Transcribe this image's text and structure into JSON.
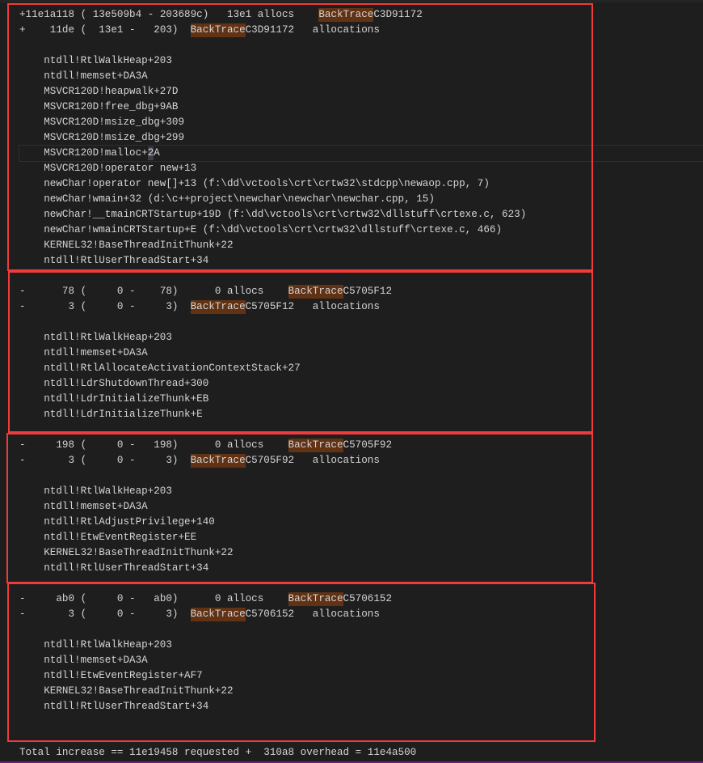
{
  "highlight_term": "BackTrace",
  "colors": {
    "highlight": "#613214",
    "box": "#ef3b3b",
    "background": "#1e1e1e",
    "text": "#d4d4d4"
  },
  "blocks": [
    {
      "header": [
        "+11e1a118 ( 13e509b4 - 203689c)   13e1 allocs    BackTraceC3D91172",
        "+    11de (  13e1 -   203)  BackTraceC3D91172   allocations"
      ],
      "frames": [
        "ntdll!RtlWalkHeap+203",
        "ntdll!memset+DA3A",
        "MSVCR120D!heapwalk+27D",
        "MSVCR120D!free_dbg+9AB",
        "MSVCR120D!msize_dbg+309",
        "MSVCR120D!msize_dbg+299",
        "MSVCR120D!malloc+2A",
        "MSVCR120D!operator new+13",
        "newChar!operator new[]+13 (f:\\dd\\vctools\\crt\\crtw32\\stdcpp\\newaop.cpp, 7)",
        "newChar!wmain+32 (d:\\c++project\\newchar\\newchar\\newchar.cpp, 15)",
        "newChar!__tmainCRTStartup+19D (f:\\dd\\vctools\\crt\\crtw32\\dllstuff\\crtexe.c, 623)",
        "newChar!wmainCRTStartup+E (f:\\dd\\vctools\\crt\\crtw32\\dllstuff\\crtexe.c, 466)",
        "KERNEL32!BaseThreadInitThunk+22",
        "ntdll!RtlUserThreadStart+34"
      ],
      "trailing_blank": 1
    },
    {
      "header": [
        "-      78 (     0 -    78)      0 allocs    BackTraceC5705F12",
        "-       3 (     0 -     3)  BackTraceC5705F12   allocations"
      ],
      "frames": [
        "ntdll!RtlWalkHeap+203",
        "ntdll!memset+DA3A",
        "ntdll!RtlAllocateActivationContextStack+27",
        "ntdll!LdrShutdownThread+300",
        "ntdll!LdrInitializeThunk+EB",
        "ntdll!LdrInitializeThunk+E"
      ],
      "trailing_blank": 1
    },
    {
      "header": [
        "-     198 (     0 -   198)      0 allocs    BackTraceC5705F92",
        "-       3 (     0 -     3)  BackTraceC5705F92   allocations"
      ],
      "frames": [
        "ntdll!RtlWalkHeap+203",
        "ntdll!memset+DA3A",
        "ntdll!RtlAdjustPrivilege+140",
        "ntdll!EtwEventRegister+EE",
        "KERNEL32!BaseThreadInitThunk+22",
        "ntdll!RtlUserThreadStart+34"
      ],
      "trailing_blank": 1
    },
    {
      "header": [
        "-     ab0 (     0 -   ab0)      0 allocs    BackTraceC5706152",
        "-       3 (     0 -     3)  BackTraceC5706152   allocations"
      ],
      "frames": [
        "ntdll!RtlWalkHeap+203",
        "ntdll!memset+DA3A",
        "ntdll!EtwEventRegister+AF7",
        "KERNEL32!BaseThreadInitThunk+22",
        "ntdll!RtlUserThreadStart+34"
      ],
      "trailing_blank": 2
    }
  ],
  "current_line": {
    "block": 0,
    "frame": 6
  },
  "total_line": "Total increase == 11e19458 requested +  310a8 overhead = 11e4a500"
}
